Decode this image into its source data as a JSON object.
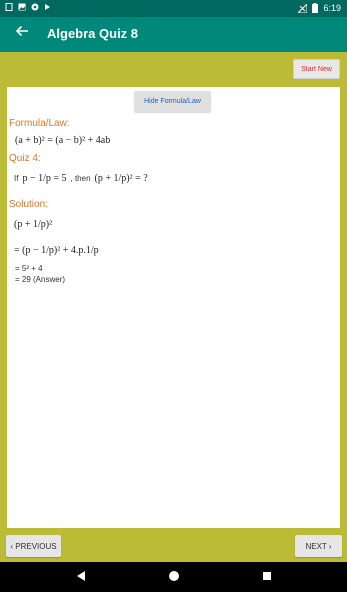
{
  "status_bar": {
    "time": "6:19",
    "left_icons": [
      "sim-icon",
      "image-icon",
      "circle-icon",
      "play-icon"
    ],
    "right_icons": [
      "signal-icon",
      "battery-icon"
    ]
  },
  "app_bar": {
    "back_icon": "arrow-left-icon",
    "title": "Algebra Quiz 8"
  },
  "start_new_label": "Start New",
  "toggle_formula_label": "Hide Formula/Law",
  "formula": {
    "heading": "Formula/Law:",
    "expression": "(a + b)² = (a − b)² + 4ab"
  },
  "quiz": {
    "heading": "Quiz 4:",
    "prefix": "If",
    "given": "p − 1/p = 5",
    "connector": ", then",
    "ask": "(p + 1/p)² = ?"
  },
  "solution": {
    "heading": "Solution:",
    "step1": "(p + 1/p)²",
    "step2": "= (p − 1/p)² + 4.p.1/p",
    "step3": "= 5² + 4",
    "step4": "= 29 (Answer)"
  },
  "nav": {
    "previous_label": "‹ PREVIOUS",
    "next_label": "NEXT ›"
  },
  "colors": {
    "status_bar": "#00695f",
    "app_bar": "#00897b",
    "background": "#bbbb36",
    "heading": "#d4782a",
    "start_new_text": "#d32f2f",
    "toggle_text": "#1e5fcc"
  }
}
